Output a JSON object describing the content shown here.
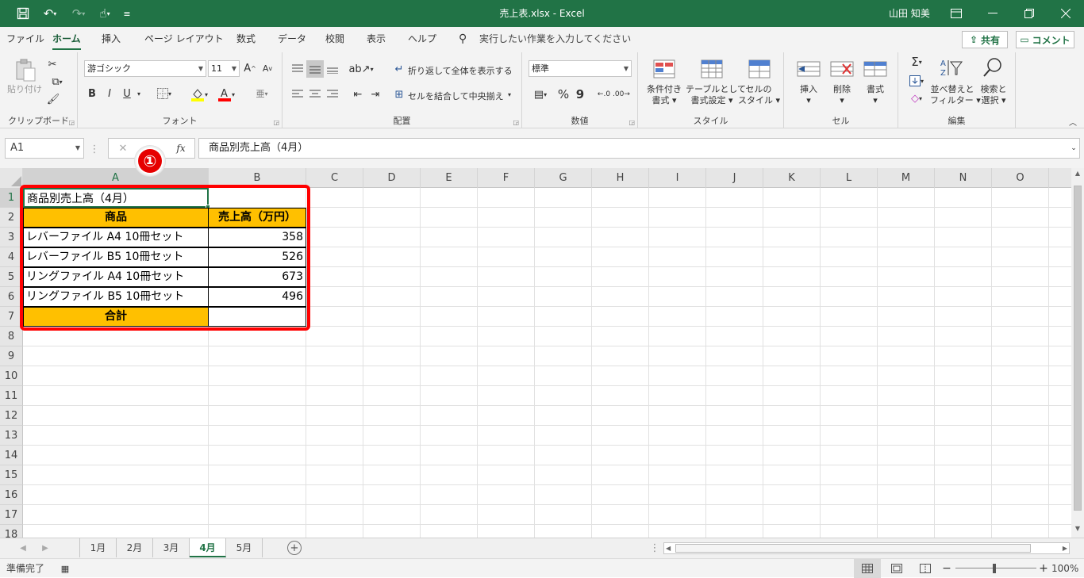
{
  "titlebar": {
    "title": "売上表.xlsx  -  Excel",
    "user": "山田 知美",
    "customize_glyph": "≡"
  },
  "ribbon_tabs": [
    "ファイル",
    "ホーム",
    "挿入",
    "ページ レイアウト",
    "数式",
    "データ",
    "校閲",
    "表示",
    "ヘルプ"
  ],
  "tell_me": "実行したい作業を入力してください",
  "share_label": "共有",
  "comment_label": "コメント",
  "ribbon": {
    "clipboard": {
      "paste": "貼り付け",
      "label": "クリップボード"
    },
    "font": {
      "name": "游ゴシック",
      "size": "11",
      "bold": "B",
      "italic": "I",
      "underline": "U",
      "grow": "A",
      "shrink": "A",
      "label": "フォント"
    },
    "alignment": {
      "wrap": "折り返して全体を表示する",
      "merge": "セルを結合して中央揃え",
      "label": "配置"
    },
    "number": {
      "format": "標準",
      "percent": "%",
      "comma": "9",
      "label": "数値"
    },
    "styles": {
      "cond_l1": "条件付き",
      "cond_l2": "書式",
      "table_l1": "テーブルとして",
      "table_l2": "書式設定",
      "cell_l1": "セルの",
      "cell_l2": "スタイル",
      "label": "スタイル"
    },
    "cells": {
      "insert": "挿入",
      "delete": "削除",
      "format": "書式",
      "label": "セル"
    },
    "editing": {
      "sort_l1": "並べ替えと",
      "sort_l2": "フィルター",
      "find_l1": "検索と",
      "find_l2": "選択",
      "label": "編集"
    }
  },
  "formula_bar": {
    "name_box": "A1",
    "formula": "商品別売上高（4月）",
    "fx": "fx",
    "callout": "①"
  },
  "columns": [
    "A",
    "B",
    "C",
    "D",
    "E",
    "F",
    "G",
    "H",
    "I",
    "J",
    "K",
    "L",
    "M",
    "N",
    "O"
  ],
  "rows": [
    "1",
    "2",
    "3",
    "4",
    "5",
    "6",
    "7",
    "8",
    "9",
    "10",
    "11",
    "12",
    "13",
    "14",
    "15",
    "16",
    "17",
    "18"
  ],
  "sheet": {
    "title": "商品別売上高（4月）",
    "header_product": "商品",
    "header_sales": "売上高（万円）",
    "items": [
      {
        "name": "レバーファイル A4 10冊セット",
        "value": "358"
      },
      {
        "name": "レバーファイル B5 10冊セット",
        "value": "526"
      },
      {
        "name": "リングファイル A4 10冊セット",
        "value": "673"
      },
      {
        "name": "リングファイル B5 10冊セット",
        "value": "496"
      }
    ],
    "total_label": "合計",
    "total_value": ""
  },
  "sheet_tabs": [
    "1月",
    "2月",
    "3月",
    "4月",
    "5月"
  ],
  "active_sheet": "4月",
  "status": {
    "ready": "準備完了",
    "zoom": "100%"
  },
  "colors": {
    "accent": "#217346",
    "header_fill": "#ffc000",
    "highlight_border": "#ff0000"
  }
}
